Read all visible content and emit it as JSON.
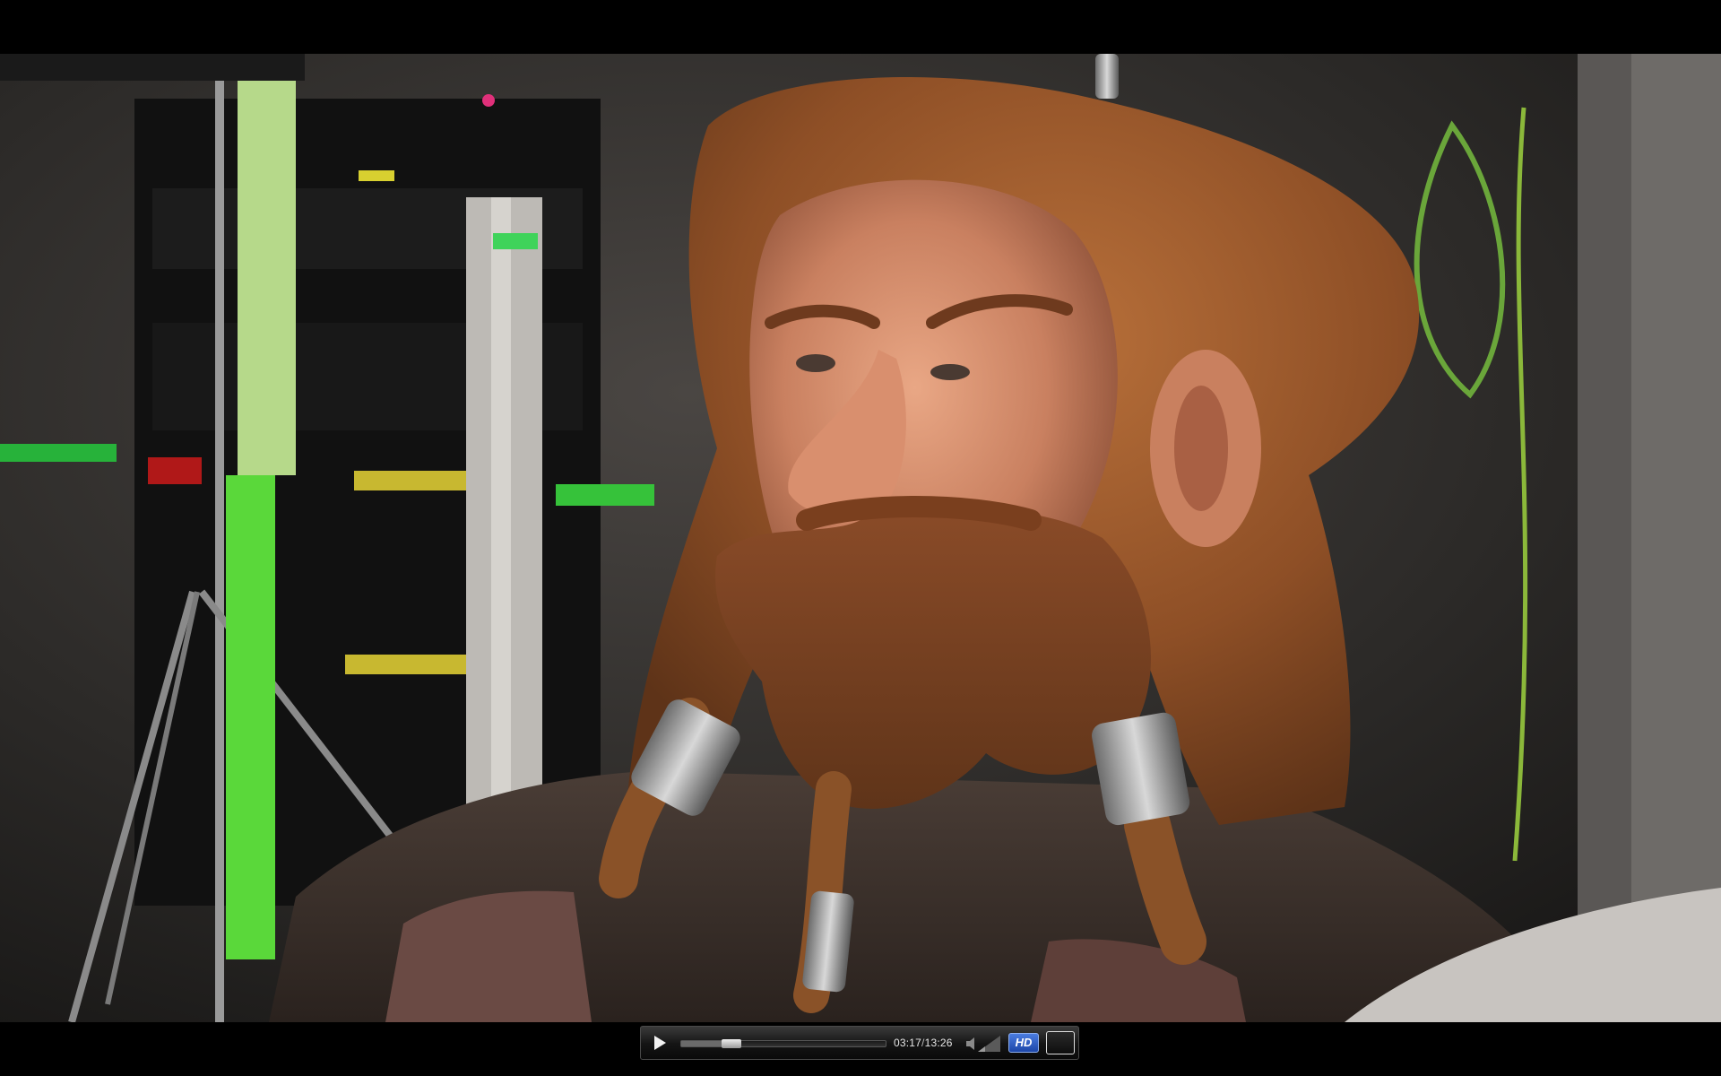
{
  "player": {
    "current_time": "03:17",
    "separator": "/",
    "duration": "13:26",
    "progress_fraction": 0.245,
    "hd_label": "HD",
    "hd_color": "#2f5fd0",
    "muted": true
  },
  "icons": {
    "play": "play-icon",
    "volume": "volume-muted-icon",
    "fullscreen": "fullscreen-icon"
  }
}
